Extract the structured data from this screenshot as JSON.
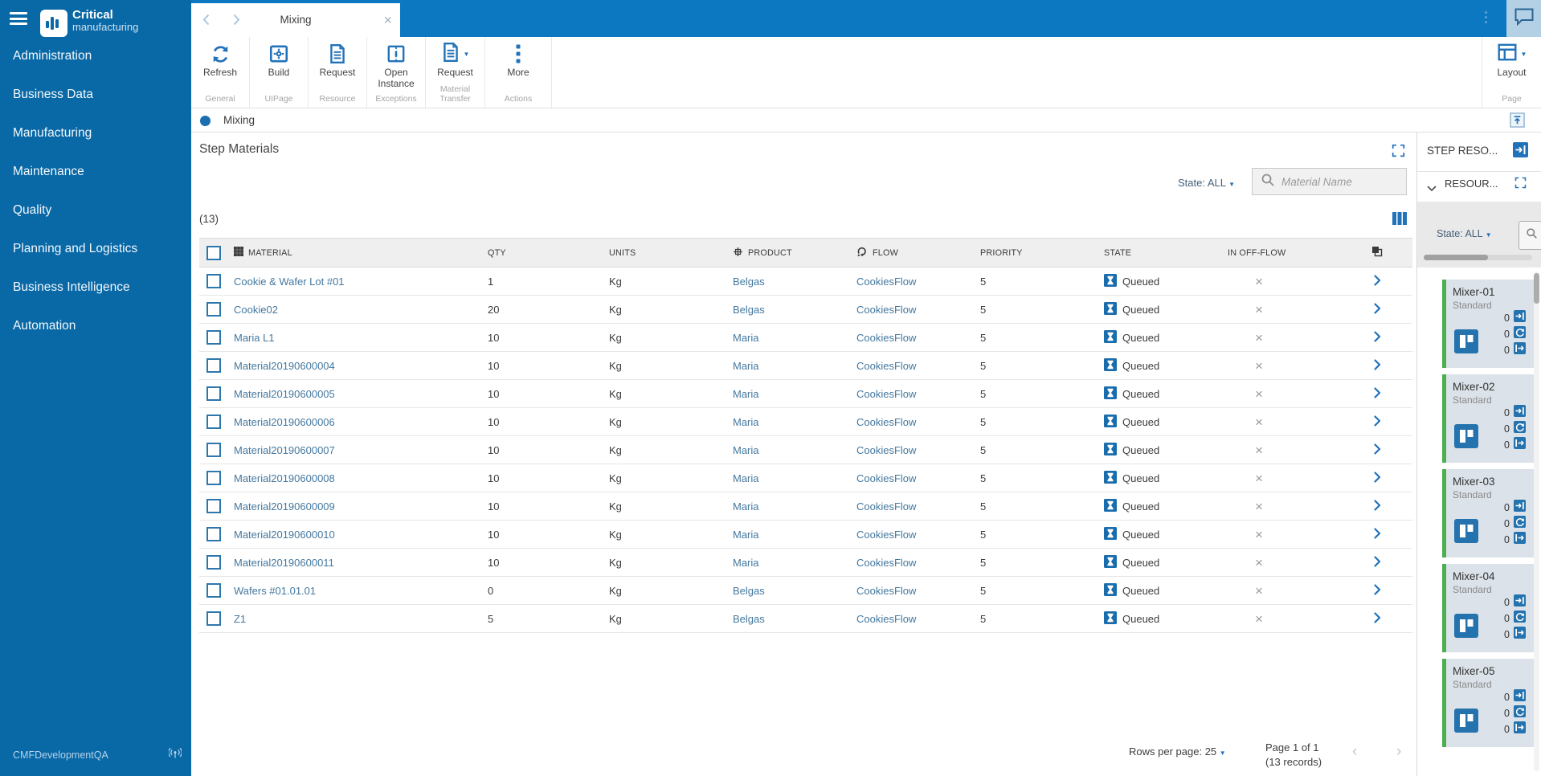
{
  "sidebar": {
    "brand": {
      "name_bold": "Critical",
      "name_light": "manufacturing"
    },
    "items": [
      "Administration",
      "Business Data",
      "Manufacturing",
      "Maintenance",
      "Quality",
      "Planning and Logistics",
      "Business Intelligence",
      "Automation"
    ],
    "footer": {
      "environment": "CMFDevelopmentQA"
    }
  },
  "tabbar": {
    "active_tab": "Mixing"
  },
  "toolbar": {
    "buttons": {
      "refresh": "Refresh",
      "build": "Build",
      "request_resource": "Request",
      "open_instance": "Open Instance",
      "request_material_transfer": "Request",
      "more": "More",
      "layout": "Layout"
    },
    "group_labels": {
      "general": "General",
      "uipage": "UIPage",
      "resource": "Resource",
      "exceptions": "Exceptions",
      "material_transfer": "Material Transfer",
      "actions": "Actions",
      "page": "Page"
    }
  },
  "breadcrumb": {
    "title": "Mixing"
  },
  "panel": {
    "title": "Step Materials",
    "state_filter_label": "State: ALL",
    "search_placeholder": "Material Name",
    "count": "(13)"
  },
  "table": {
    "columns": [
      "",
      "MATERIAL",
      "",
      "QTY",
      "UNITS",
      "PRODUCT",
      "FLOW",
      "PRIORITY",
      "STATE",
      "IN OFF-FLOW",
      ""
    ],
    "rows": [
      {
        "material": "Cookie & Wafer Lot #01",
        "qty": "1",
        "units": "Kg",
        "product": "Belgas",
        "flow": "CookiesFlow",
        "priority": "5",
        "state": "Queued"
      },
      {
        "material": "Cookie02",
        "qty": "20",
        "units": "Kg",
        "product": "Belgas",
        "flow": "CookiesFlow",
        "priority": "5",
        "state": "Queued"
      },
      {
        "material": "Maria L1",
        "qty": "10",
        "units": "Kg",
        "product": "Maria",
        "flow": "CookiesFlow",
        "priority": "5",
        "state": "Queued"
      },
      {
        "material": "Material20190600004",
        "qty": "10",
        "units": "Kg",
        "product": "Maria",
        "flow": "CookiesFlow",
        "priority": "5",
        "state": "Queued"
      },
      {
        "material": "Material20190600005",
        "qty": "10",
        "units": "Kg",
        "product": "Maria",
        "flow": "CookiesFlow",
        "priority": "5",
        "state": "Queued"
      },
      {
        "material": "Material20190600006",
        "qty": "10",
        "units": "Kg",
        "product": "Maria",
        "flow": "CookiesFlow",
        "priority": "5",
        "state": "Queued"
      },
      {
        "material": "Material20190600007",
        "qty": "10",
        "units": "Kg",
        "product": "Maria",
        "flow": "CookiesFlow",
        "priority": "5",
        "state": "Queued"
      },
      {
        "material": "Material20190600008",
        "qty": "10",
        "units": "Kg",
        "product": "Maria",
        "flow": "CookiesFlow",
        "priority": "5",
        "state": "Queued"
      },
      {
        "material": "Material20190600009",
        "qty": "10",
        "units": "Kg",
        "product": "Maria",
        "flow": "CookiesFlow",
        "priority": "5",
        "state": "Queued"
      },
      {
        "material": "Material20190600010",
        "qty": "10",
        "units": "Kg",
        "product": "Maria",
        "flow": "CookiesFlow",
        "priority": "5",
        "state": "Queued"
      },
      {
        "material": "Material20190600011",
        "qty": "10",
        "units": "Kg",
        "product": "Maria",
        "flow": "CookiesFlow",
        "priority": "5",
        "state": "Queued"
      },
      {
        "material": "Wafers #01.01.01",
        "qty": "0",
        "units": "Kg",
        "product": "Belgas",
        "flow": "CookiesFlow",
        "priority": "5",
        "state": "Queued"
      },
      {
        "material": "Z1",
        "qty": "5",
        "units": "Kg",
        "product": "Belgas",
        "flow": "CookiesFlow",
        "priority": "5",
        "state": "Queued"
      }
    ],
    "row_icons": {
      "state_icon": "hourglass-queued",
      "in_off_flow_icon": "x-mark",
      "detail_icon": "chevron-right"
    }
  },
  "pagination": {
    "rows_per_page_label": "Rows per page:",
    "rows_per_page_value": "25",
    "page_info": "Page 1 of 1",
    "records_info": "(13 records)"
  },
  "right_panel": {
    "title": "STEP RESO...",
    "section_title": "RESOUR...",
    "state_filter_label": "State: ALL",
    "resources": [
      {
        "name": "Mixer-01",
        "type": "Standard",
        "counts": [
          "0",
          "0",
          "0"
        ]
      },
      {
        "name": "Mixer-02",
        "type": "Standard",
        "counts": [
          "0",
          "0",
          "0"
        ]
      },
      {
        "name": "Mixer-03",
        "type": "Standard",
        "counts": [
          "0",
          "0",
          "0"
        ]
      },
      {
        "name": "Mixer-04",
        "type": "Standard",
        "counts": [
          "0",
          "0",
          "0"
        ]
      },
      {
        "name": "Mixer-05",
        "type": "Standard",
        "counts": [
          "0",
          "0",
          "0"
        ]
      }
    ]
  },
  "colors": {
    "sidebar_blue": "#0968a6",
    "topbar_blue": "#0c78c1",
    "accent_blue": "#2272b9",
    "link_blue": "#44789f",
    "queued_icon_blue": "#1a6dad",
    "resource_green": "#4cb050",
    "card_background": "#dbe2e9"
  }
}
